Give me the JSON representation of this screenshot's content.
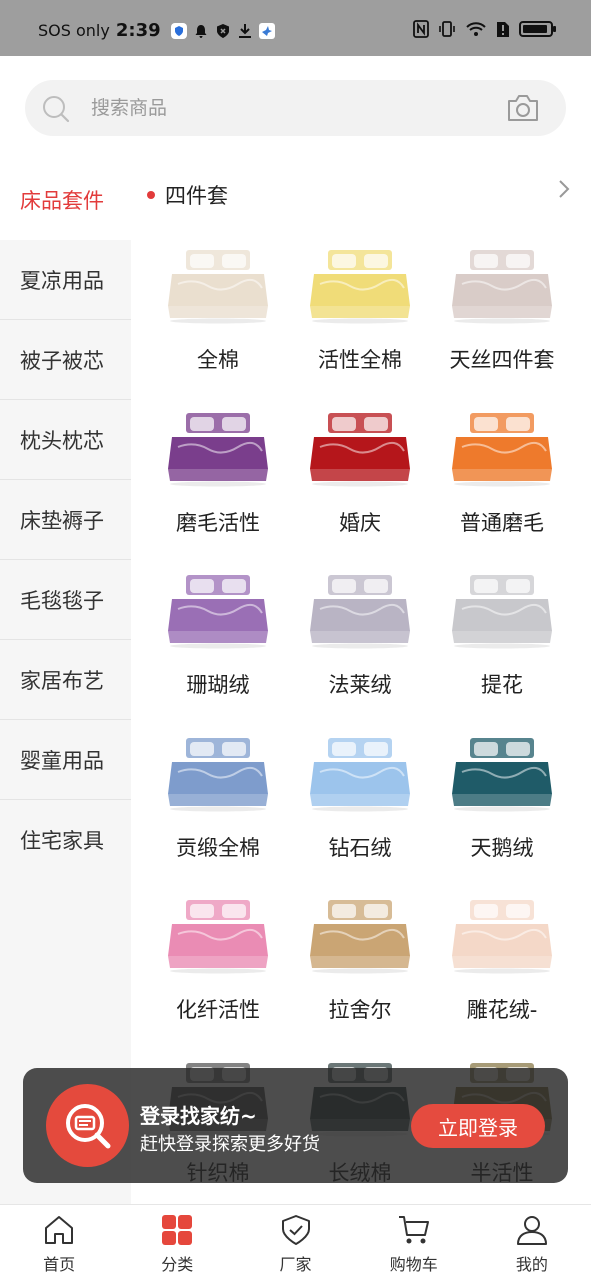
{
  "status_bar": {
    "carrier": "SOS only",
    "time": "2:39"
  },
  "search": {
    "placeholder": "搜索商品"
  },
  "sidebar": {
    "items": [
      {
        "label": "床品套件"
      },
      {
        "label": "夏凉用品"
      },
      {
        "label": "被子被芯"
      },
      {
        "label": "枕头枕芯"
      },
      {
        "label": "床垫褥子"
      },
      {
        "label": "毛毯毯子"
      },
      {
        "label": "家居布艺"
      },
      {
        "label": "婴童用品"
      },
      {
        "label": "住宅家具"
      }
    ]
  },
  "section": {
    "title": "四件套"
  },
  "products": [
    {
      "label": "全棉",
      "color": "#eadfcf"
    },
    {
      "label": "活性全棉",
      "color": "#f0dc78"
    },
    {
      "label": "天丝四件套",
      "color": "#d9ccc8"
    },
    {
      "label": "磨毛活性",
      "color": "#7a3e8c"
    },
    {
      "label": "婚庆",
      "color": "#b5161b"
    },
    {
      "label": "普通磨毛",
      "color": "#ee7a2c"
    },
    {
      "label": "珊瑚绒",
      "color": "#9a6fb5"
    },
    {
      "label": "法莱绒",
      "color": "#b9b4c4"
    },
    {
      "label": "提花",
      "color": "#c8c8cc"
    },
    {
      "label": "贡缎全棉",
      "color": "#7e9ccc"
    },
    {
      "label": "钻石绒",
      "color": "#9cc4ec"
    },
    {
      "label": "天鹅绒",
      "color": "#1f5b68"
    },
    {
      "label": "化纤活性",
      "color": "#ea8cb4"
    },
    {
      "label": "拉舍尔",
      "color": "#caa574"
    },
    {
      "label": "雕花绒-",
      "color": "#f4d8c8"
    },
    {
      "label": "针织棉",
      "color": "#5a5a5a"
    },
    {
      "label": "长绒棉",
      "color": "#3a4a4a"
    },
    {
      "label": "半活性",
      "color": "#8a7a4a"
    }
  ],
  "banner": {
    "title": "登录找家纺~",
    "subtitle": "赶快登录探索更多好货",
    "button": "立即登录"
  },
  "bottom_nav": {
    "items": [
      {
        "label": "首页",
        "icon": "home-icon"
      },
      {
        "label": "分类",
        "icon": "category-icon"
      },
      {
        "label": "厂家",
        "icon": "shield-check-icon"
      },
      {
        "label": "购物车",
        "icon": "cart-icon"
      },
      {
        "label": "我的",
        "icon": "user-icon"
      }
    ]
  },
  "colors": {
    "accent": "#e23b3b",
    "sidebar_bg": "#f6f6f6",
    "banner_button": "#e54b3f"
  }
}
